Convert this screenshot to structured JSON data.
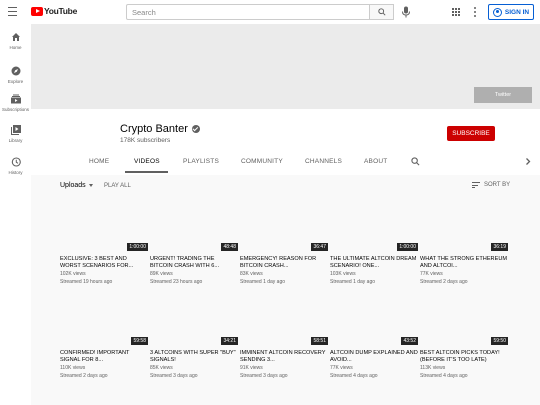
{
  "app": {
    "logo_text": "YouTube",
    "search_placeholder": "Search",
    "signin_label": "SIGN IN"
  },
  "sidebar": {
    "items": [
      {
        "label": "Home",
        "icon": "home-icon"
      },
      {
        "label": "Explore",
        "icon": "compass-icon"
      },
      {
        "label": "Subscriptions",
        "icon": "subscriptions-icon"
      },
      {
        "label": "Library",
        "icon": "library-icon"
      },
      {
        "label": "History",
        "icon": "history-icon"
      }
    ]
  },
  "banner": {
    "link_label": "Twitter"
  },
  "channel": {
    "name": "Crypto Banter",
    "subscribers": "178K subscribers",
    "subscribe_label": "SUBSCRIBE"
  },
  "tabs": [
    {
      "label": "HOME",
      "active": false
    },
    {
      "label": "VIDEOS",
      "active": true
    },
    {
      "label": "PLAYLISTS",
      "active": false
    },
    {
      "label": "COMMUNITY",
      "active": false
    },
    {
      "label": "CHANNELS",
      "active": false
    },
    {
      "label": "ABOUT",
      "active": false
    }
  ],
  "uploads": {
    "label": "Uploads",
    "play_all": "PLAY ALL",
    "sort_by": "SORT BY"
  },
  "videos": [
    {
      "title": "EXCLUSIVE: 3 BEST AND WORST SCENARIOS FOR...",
      "duration": "1:00:00",
      "views": "102K views",
      "age": "Streamed 19 hours ago"
    },
    {
      "title": "URGENT! TRADING THE BITCOIN CRASH WITH 6...",
      "duration": "48:48",
      "views": "89K views",
      "age": "Streamed 23 hours ago"
    },
    {
      "title": "EMERGENCY! REASON FOR BITCOIN CRASH...",
      "duration": "36:47",
      "views": "83K views",
      "age": "Streamed 1 day ago"
    },
    {
      "title": "THE ULTIMATE ALTCOIN DREAM SCENARIO! ONE...",
      "duration": "1:00:00",
      "views": "103K views",
      "age": "Streamed 1 day ago"
    },
    {
      "title": "WHAT THE STRONG ETHEREUM AND ALTCOI...",
      "duration": "36:19",
      "views": "77K views",
      "age": "Streamed 2 days ago"
    },
    {
      "title": "CONFIRMED! IMPORTANT SIGNAL FOR 8...",
      "duration": "59:58",
      "views": "110K views",
      "age": "Streamed 2 days ago"
    },
    {
      "title": "3 ALTCOINS WITH SUPER \"BUY\" SIGNALS!",
      "duration": "34:21",
      "views": "85K views",
      "age": "Streamed 3 days ago"
    },
    {
      "title": "IMMINENT ALTCOIN RECOVERY SENDING 3...",
      "duration": "58:51",
      "views": "91K views",
      "age": "Streamed 3 days ago"
    },
    {
      "title": "ALTCOIN DUMP EXPLAINED AND AVOID...",
      "duration": "43:52",
      "views": "77K views",
      "age": "Streamed 4 days ago"
    },
    {
      "title": "BEST ALTCOIN PICKS TODAY! (Before it's too late)",
      "duration": "59:50",
      "views": "113K views",
      "age": "Streamed 4 days ago"
    }
  ]
}
